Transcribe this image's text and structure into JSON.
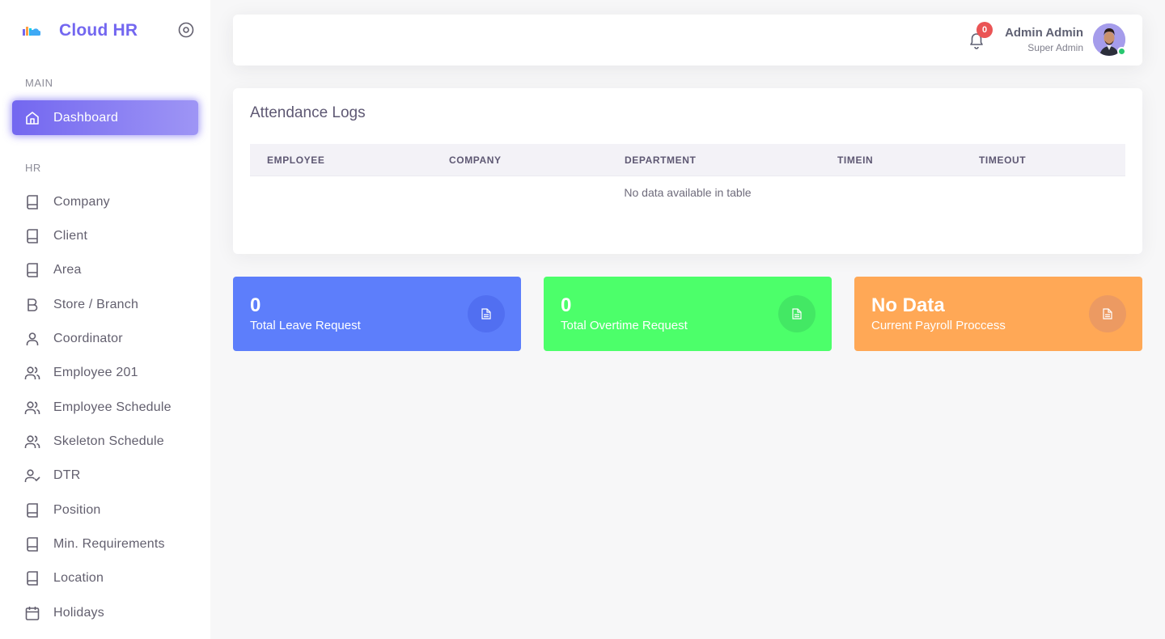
{
  "app": {
    "title": "Cloud HR"
  },
  "sidebar": {
    "main_label": "MAIN",
    "hr_label": "HR",
    "active_item": {
      "label": "Dashboard",
      "icon": "home-icon"
    },
    "items": [
      {
        "label": "Company",
        "icon": "book-icon"
      },
      {
        "label": "Client",
        "icon": "book-icon"
      },
      {
        "label": "Area",
        "icon": "book-icon"
      },
      {
        "label": "Store / Branch",
        "icon": "bold-b-icon"
      },
      {
        "label": "Coordinator",
        "icon": "user-icon"
      },
      {
        "label": "Employee 201",
        "icon": "users-icon"
      },
      {
        "label": "Employee Schedule",
        "icon": "users-icon"
      },
      {
        "label": "Skeleton Schedule",
        "icon": "users-icon"
      },
      {
        "label": "DTR",
        "icon": "user-check-icon"
      },
      {
        "label": "Position",
        "icon": "book-icon"
      },
      {
        "label": "Min. Requirements",
        "icon": "book-icon"
      },
      {
        "label": "Location",
        "icon": "book-icon"
      },
      {
        "label": "Holidays",
        "icon": "calendar-icon"
      }
    ]
  },
  "topbar": {
    "notifications_count": "0",
    "user_name": "Admin Admin",
    "user_role": "Super Admin"
  },
  "attendance": {
    "title": "Attendance Logs",
    "columns": [
      "EMPLOYEE",
      "COMPANY",
      "DEPARTMENT",
      "TIMEIN",
      "TIMEOUT"
    ],
    "empty_text": "No data available in table"
  },
  "stats": [
    {
      "value": "0",
      "label": "Total Leave Request",
      "color": "#5d7efb"
    },
    {
      "value": "0",
      "label": "Total Overtime Request",
      "color": "#4cff6a"
    },
    {
      "value": "No Data",
      "label": "Current Payroll Proccess",
      "color": "#ffa856"
    }
  ],
  "colors": {
    "primary": "#7367f0",
    "badge": "#ea5455",
    "online": "#28c76f"
  }
}
